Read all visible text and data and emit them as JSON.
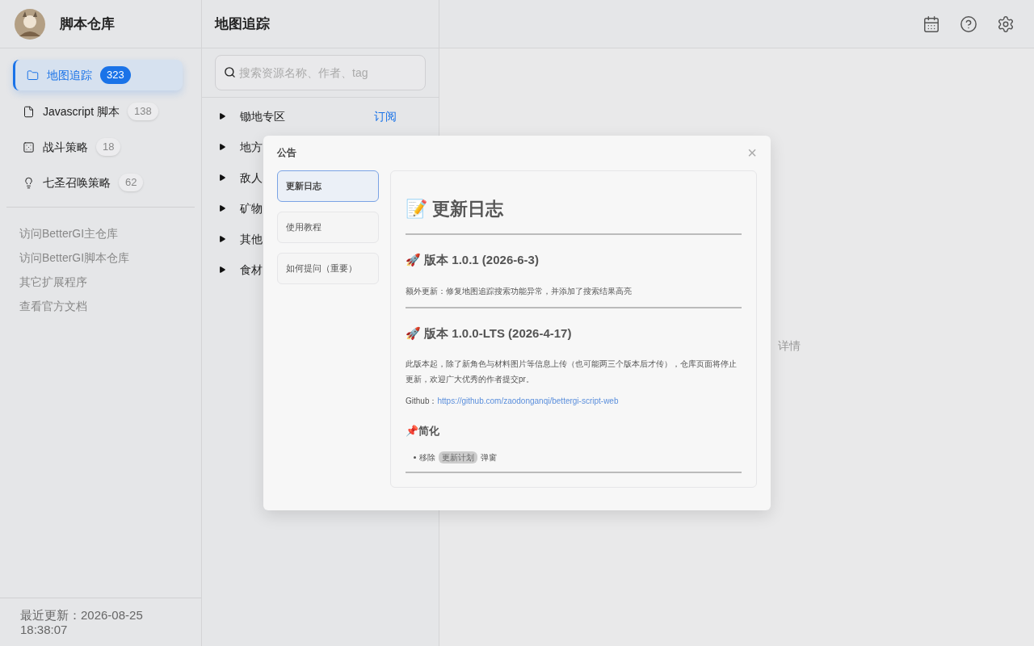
{
  "sidebar": {
    "title": "脚本仓库",
    "items": [
      {
        "label": "地图追踪",
        "count": "323",
        "selected": true,
        "kind": "folder"
      },
      {
        "label": "Javascript 脚本",
        "count": "138",
        "selected": false,
        "kind": "file"
      },
      {
        "label": "战斗策略",
        "count": "18",
        "selected": false,
        "kind": "dice"
      },
      {
        "label": "七圣召唤策略",
        "count": "62",
        "selected": false,
        "kind": "bulb"
      }
    ],
    "links": [
      "访问BetterGI主仓库",
      "访问BetterGI脚本仓库",
      "其它扩展程序",
      "查看官方文档"
    ],
    "footer": "最近更新：2026-08-25 18:38:07"
  },
  "middle": {
    "title": "地图追踪",
    "search": {
      "placeholder": "搜索资源名称、作者、tag"
    },
    "rows": [
      {
        "label": "锄地专区",
        "action": "订阅"
      },
      {
        "label": "地方"
      },
      {
        "label": "敌人"
      },
      {
        "label": "矿物"
      },
      {
        "label": "其他"
      },
      {
        "label": "食材"
      }
    ]
  },
  "detail": {
    "empty_hint": "详情"
  },
  "dialog": {
    "title": "公告",
    "close": "×",
    "tabs": [
      {
        "label": "更新日志",
        "selected": true
      },
      {
        "label": "使用教程",
        "selected": false
      },
      {
        "label": "如何提问（重要）",
        "selected": false
      }
    ],
    "heading": "📝 更新日志",
    "sections": [
      {
        "title": "🚀 版本 1.0.1 (2026-6-3)",
        "paragraphs": [
          "额外更新：修复地图追踪搜索功能异常，并添加了搜索结果高亮"
        ]
      },
      {
        "title": "🚀 版本 1.0.0-LTS (2026-4-17)",
        "paragraphs": [
          "此版本起，除了新角色与材料图片等信息上传（也可能两三个版本后才传），仓库页面将停止更新，欢迎广大优秀的作者提交pr。"
        ],
        "link_label": "Github：",
        "link": "https://github.com/zaodonganqi/bettergi-script-web",
        "subheading": "📌简化",
        "bullet": {
          "before": "移除",
          "code": "更新计划",
          "after": "弹窗"
        }
      }
    ]
  }
}
